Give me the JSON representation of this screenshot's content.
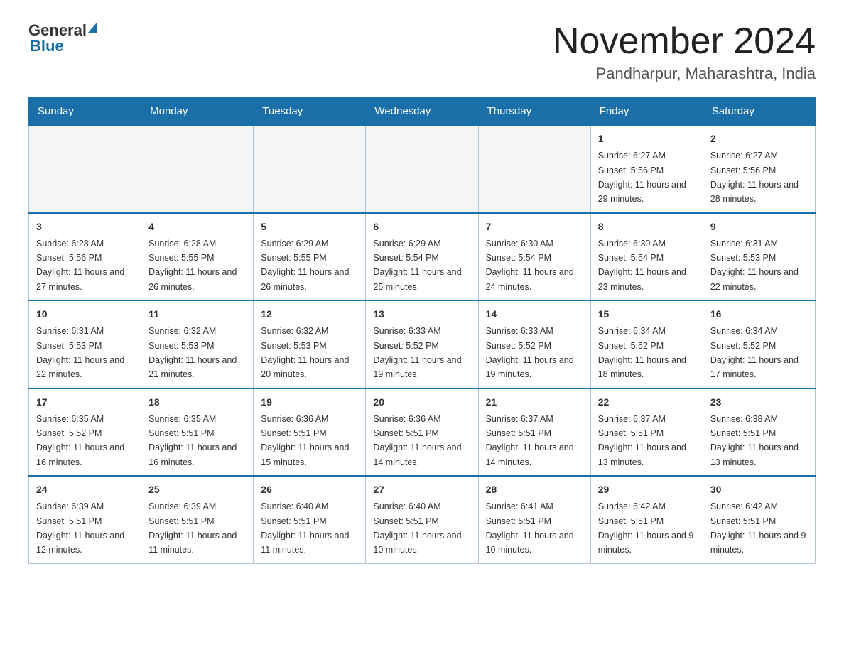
{
  "header": {
    "logo_general": "General",
    "logo_blue": "Blue",
    "title": "November 2024",
    "subtitle": "Pandharpur, Maharashtra, India"
  },
  "calendar": {
    "days_of_week": [
      "Sunday",
      "Monday",
      "Tuesday",
      "Wednesday",
      "Thursday",
      "Friday",
      "Saturday"
    ],
    "weeks": [
      [
        {
          "day": "",
          "info": ""
        },
        {
          "day": "",
          "info": ""
        },
        {
          "day": "",
          "info": ""
        },
        {
          "day": "",
          "info": ""
        },
        {
          "day": "",
          "info": ""
        },
        {
          "day": "1",
          "info": "Sunrise: 6:27 AM\nSunset: 5:56 PM\nDaylight: 11 hours and 29 minutes."
        },
        {
          "day": "2",
          "info": "Sunrise: 6:27 AM\nSunset: 5:56 PM\nDaylight: 11 hours and 28 minutes."
        }
      ],
      [
        {
          "day": "3",
          "info": "Sunrise: 6:28 AM\nSunset: 5:56 PM\nDaylight: 11 hours and 27 minutes."
        },
        {
          "day": "4",
          "info": "Sunrise: 6:28 AM\nSunset: 5:55 PM\nDaylight: 11 hours and 26 minutes."
        },
        {
          "day": "5",
          "info": "Sunrise: 6:29 AM\nSunset: 5:55 PM\nDaylight: 11 hours and 26 minutes."
        },
        {
          "day": "6",
          "info": "Sunrise: 6:29 AM\nSunset: 5:54 PM\nDaylight: 11 hours and 25 minutes."
        },
        {
          "day": "7",
          "info": "Sunrise: 6:30 AM\nSunset: 5:54 PM\nDaylight: 11 hours and 24 minutes."
        },
        {
          "day": "8",
          "info": "Sunrise: 6:30 AM\nSunset: 5:54 PM\nDaylight: 11 hours and 23 minutes."
        },
        {
          "day": "9",
          "info": "Sunrise: 6:31 AM\nSunset: 5:53 PM\nDaylight: 11 hours and 22 minutes."
        }
      ],
      [
        {
          "day": "10",
          "info": "Sunrise: 6:31 AM\nSunset: 5:53 PM\nDaylight: 11 hours and 22 minutes."
        },
        {
          "day": "11",
          "info": "Sunrise: 6:32 AM\nSunset: 5:53 PM\nDaylight: 11 hours and 21 minutes."
        },
        {
          "day": "12",
          "info": "Sunrise: 6:32 AM\nSunset: 5:53 PM\nDaylight: 11 hours and 20 minutes."
        },
        {
          "day": "13",
          "info": "Sunrise: 6:33 AM\nSunset: 5:52 PM\nDaylight: 11 hours and 19 minutes."
        },
        {
          "day": "14",
          "info": "Sunrise: 6:33 AM\nSunset: 5:52 PM\nDaylight: 11 hours and 19 minutes."
        },
        {
          "day": "15",
          "info": "Sunrise: 6:34 AM\nSunset: 5:52 PM\nDaylight: 11 hours and 18 minutes."
        },
        {
          "day": "16",
          "info": "Sunrise: 6:34 AM\nSunset: 5:52 PM\nDaylight: 11 hours and 17 minutes."
        }
      ],
      [
        {
          "day": "17",
          "info": "Sunrise: 6:35 AM\nSunset: 5:52 PM\nDaylight: 11 hours and 16 minutes."
        },
        {
          "day": "18",
          "info": "Sunrise: 6:35 AM\nSunset: 5:51 PM\nDaylight: 11 hours and 16 minutes."
        },
        {
          "day": "19",
          "info": "Sunrise: 6:36 AM\nSunset: 5:51 PM\nDaylight: 11 hours and 15 minutes."
        },
        {
          "day": "20",
          "info": "Sunrise: 6:36 AM\nSunset: 5:51 PM\nDaylight: 11 hours and 14 minutes."
        },
        {
          "day": "21",
          "info": "Sunrise: 6:37 AM\nSunset: 5:51 PM\nDaylight: 11 hours and 14 minutes."
        },
        {
          "day": "22",
          "info": "Sunrise: 6:37 AM\nSunset: 5:51 PM\nDaylight: 11 hours and 13 minutes."
        },
        {
          "day": "23",
          "info": "Sunrise: 6:38 AM\nSunset: 5:51 PM\nDaylight: 11 hours and 13 minutes."
        }
      ],
      [
        {
          "day": "24",
          "info": "Sunrise: 6:39 AM\nSunset: 5:51 PM\nDaylight: 11 hours and 12 minutes."
        },
        {
          "day": "25",
          "info": "Sunrise: 6:39 AM\nSunset: 5:51 PM\nDaylight: 11 hours and 11 minutes."
        },
        {
          "day": "26",
          "info": "Sunrise: 6:40 AM\nSunset: 5:51 PM\nDaylight: 11 hours and 11 minutes."
        },
        {
          "day": "27",
          "info": "Sunrise: 6:40 AM\nSunset: 5:51 PM\nDaylight: 11 hours and 10 minutes."
        },
        {
          "day": "28",
          "info": "Sunrise: 6:41 AM\nSunset: 5:51 PM\nDaylight: 11 hours and 10 minutes."
        },
        {
          "day": "29",
          "info": "Sunrise: 6:42 AM\nSunset: 5:51 PM\nDaylight: 11 hours and 9 minutes."
        },
        {
          "day": "30",
          "info": "Sunrise: 6:42 AM\nSunset: 5:51 PM\nDaylight: 11 hours and 9 minutes."
        }
      ]
    ]
  }
}
